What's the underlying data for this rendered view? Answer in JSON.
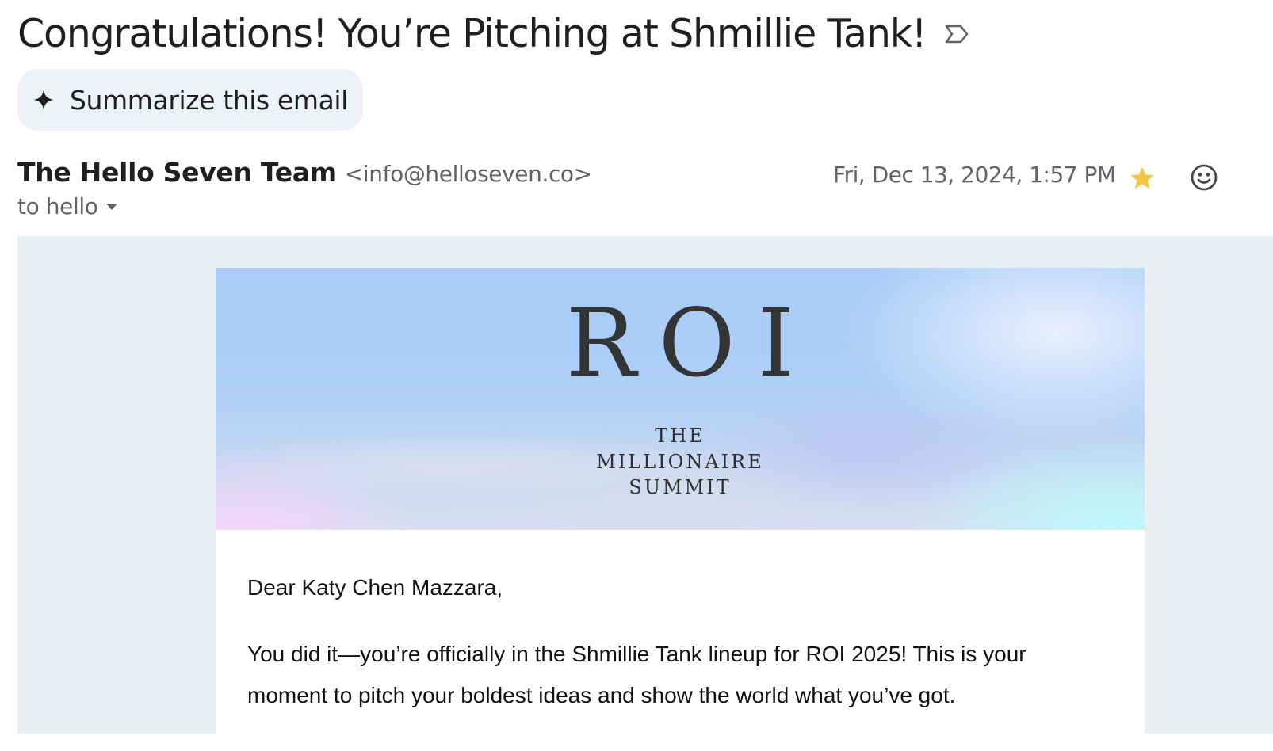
{
  "email": {
    "subject": "Congratulations! You’re Pitching at Shmillie Tank!",
    "summarize_label": "Summarize this email",
    "sender_name": "The Hello Seven Team",
    "sender_email": "<info@helloseven.co>",
    "to_label": "to hello",
    "date": "Fri, Dec 13, 2024, 1:57 PM",
    "starred": true,
    "icons": {
      "important": "important-marker-icon",
      "sparkle": "sparkle-icon",
      "caret": "caret-down-icon",
      "star": "star-icon",
      "emoji": "emoji-reaction-icon"
    },
    "colors": {
      "star": "#f4c443",
      "body_bg": "#e9eef3",
      "summarize_bg": "#eef2f7"
    }
  },
  "banner": {
    "logo_text": "ROI",
    "tagline_line1": "THE",
    "tagline_line2": "MILLIONAIRE",
    "tagline_line3": "SUMMIT"
  },
  "body": {
    "greeting": "Dear Katy Chen Mazzara,",
    "paragraph1": "You did it—you’re officially in the Shmillie Tank lineup for ROI 2025! This is your moment to pitch your boldest ideas and show the world what you’ve got."
  }
}
